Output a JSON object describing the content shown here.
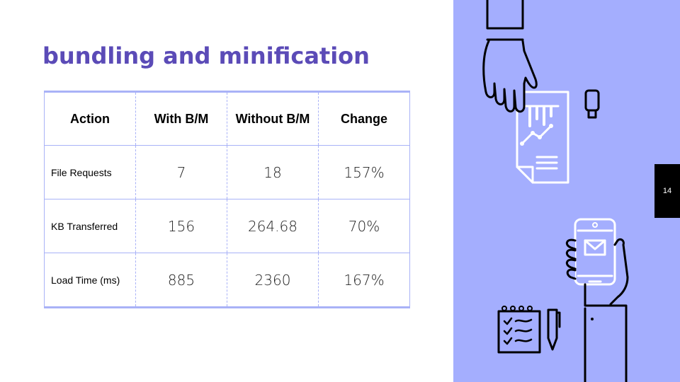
{
  "slide": {
    "title": "bundling and minification",
    "page_number": "14"
  },
  "table": {
    "headers": [
      "Action",
      "With B/M",
      "Without B/M",
      "Change"
    ],
    "rows": [
      [
        "File Requests",
        "7",
        "18",
        "157%"
      ],
      [
        "KB Transferred",
        "156",
        "264.68",
        "70%"
      ],
      [
        "Load Time (ms)",
        "885",
        "2360",
        "167%"
      ]
    ]
  },
  "theme": {
    "title_color": "#5b4bb7",
    "panel_color": "#a4aefe",
    "table_border_color": "#a9b2f7"
  },
  "illustration": {
    "icons": [
      "hand-holding-document-icon",
      "usb-drive-icon",
      "hand-holding-phone-icon",
      "notepad-icon",
      "pen-icon"
    ]
  }
}
